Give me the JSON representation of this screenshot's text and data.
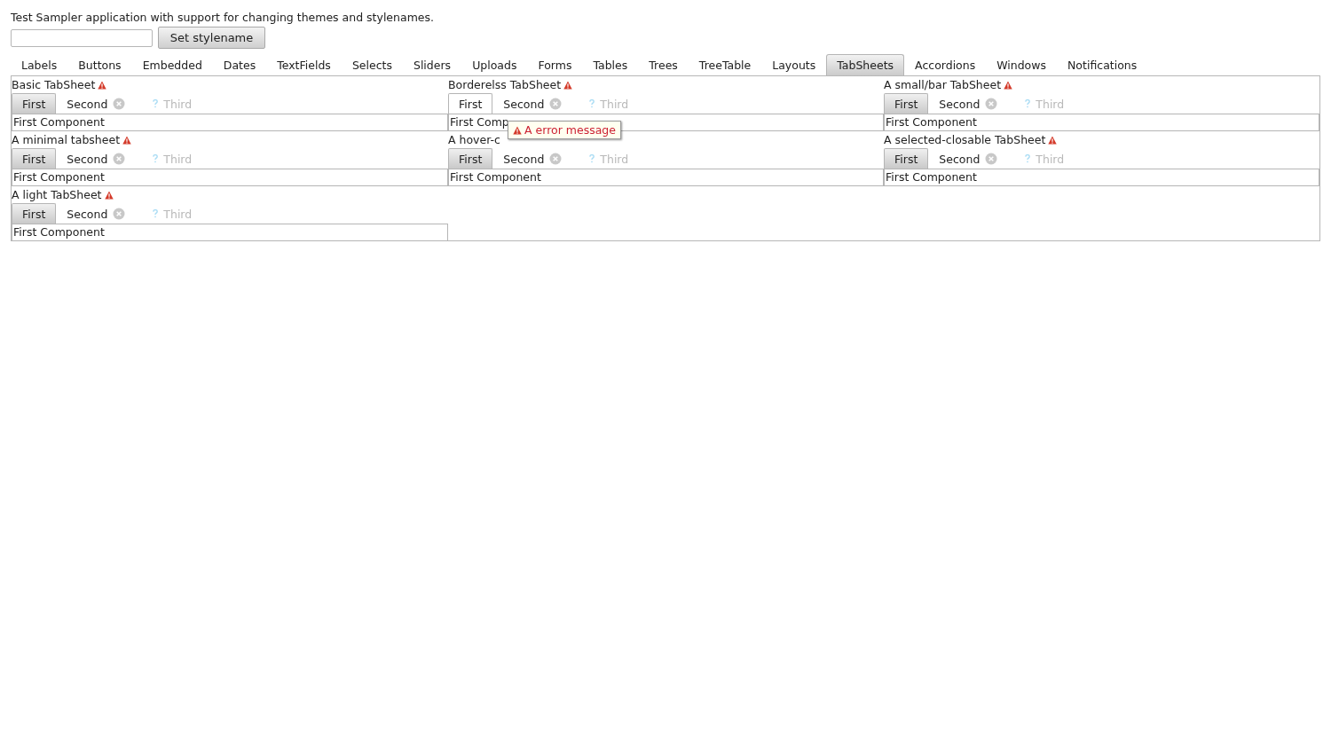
{
  "intro": "Test Sampler application with support for changing themes and stylenames.",
  "set_button": "Set stylename",
  "main_tabs": [
    {
      "label": "Labels",
      "selected": false
    },
    {
      "label": "Buttons",
      "selected": false
    },
    {
      "label": "Embedded",
      "selected": false
    },
    {
      "label": "Dates",
      "selected": false
    },
    {
      "label": "TextFields",
      "selected": false
    },
    {
      "label": "Selects",
      "selected": false
    },
    {
      "label": "Sliders",
      "selected": false
    },
    {
      "label": "Uploads",
      "selected": false
    },
    {
      "label": "Forms",
      "selected": false
    },
    {
      "label": "Tables",
      "selected": false
    },
    {
      "label": "Trees",
      "selected": false
    },
    {
      "label": "TreeTable",
      "selected": false
    },
    {
      "label": "Layouts",
      "selected": false
    },
    {
      "label": "TabSheets",
      "selected": true
    },
    {
      "label": "Accordions",
      "selected": false
    },
    {
      "label": "Windows",
      "selected": false
    },
    {
      "label": "Notifications",
      "selected": false
    }
  ],
  "sheets": [
    {
      "caption": "Basic TabSheet",
      "error": true,
      "kind": "default",
      "tabs": [
        {
          "label": "First",
          "selected": true,
          "closable": false,
          "disabled": false
        },
        {
          "label": "Second",
          "selected": false,
          "closable": true,
          "disabled": false
        },
        {
          "label": "Third",
          "selected": false,
          "closable": false,
          "disabled": true
        }
      ],
      "content": "First Component"
    },
    {
      "caption": "Borderelss TabSheet",
      "error": true,
      "kind": "borderless",
      "tabs": [
        {
          "label": "First",
          "selected": true,
          "closable": false,
          "disabled": false
        },
        {
          "label": "Second",
          "selected": false,
          "closable": true,
          "disabled": false
        },
        {
          "label": "Third",
          "selected": false,
          "closable": false,
          "disabled": true
        }
      ],
      "content": "First Comp",
      "tooltip": "A error message"
    },
    {
      "caption": "A small/bar TabSheet",
      "error": true,
      "kind": "default",
      "tabs": [
        {
          "label": "First",
          "selected": true,
          "closable": false,
          "disabled": false
        },
        {
          "label": "Second",
          "selected": false,
          "closable": true,
          "disabled": false
        },
        {
          "label": "Third",
          "selected": false,
          "closable": false,
          "disabled": true
        }
      ],
      "content": "First Component"
    },
    {
      "caption": "A minimal tabsheet",
      "error": true,
      "kind": "default",
      "tabs": [
        {
          "label": "First",
          "selected": true,
          "closable": false,
          "disabled": false
        },
        {
          "label": "Second",
          "selected": false,
          "closable": true,
          "disabled": false
        },
        {
          "label": "Third",
          "selected": false,
          "closable": false,
          "disabled": true
        }
      ],
      "content": "First Component"
    },
    {
      "caption": "A hover-c",
      "kind": "default",
      "tabs": [
        {
          "label": "First",
          "selected": true,
          "closable": false,
          "disabled": false
        },
        {
          "label": "Second",
          "selected": false,
          "closable": true,
          "disabled": false
        },
        {
          "label": "Third",
          "selected": false,
          "closable": false,
          "disabled": true
        }
      ],
      "content": "First Component"
    },
    {
      "caption": "A selected-closable TabSheet",
      "error": true,
      "kind": "default",
      "tabs": [
        {
          "label": "First",
          "selected": true,
          "closable": false,
          "disabled": false
        },
        {
          "label": "Second",
          "selected": false,
          "closable": true,
          "disabled": false
        },
        {
          "label": "Third",
          "selected": false,
          "closable": false,
          "disabled": true
        }
      ],
      "content": "First Component"
    },
    {
      "caption": "A light TabSheet",
      "error": true,
      "kind": "default",
      "tabs": [
        {
          "label": "First",
          "selected": true,
          "closable": false,
          "disabled": false
        },
        {
          "label": "Second",
          "selected": false,
          "closable": true,
          "disabled": false
        },
        {
          "label": "Third",
          "selected": false,
          "closable": false,
          "disabled": true
        }
      ],
      "content": "First Component"
    }
  ]
}
